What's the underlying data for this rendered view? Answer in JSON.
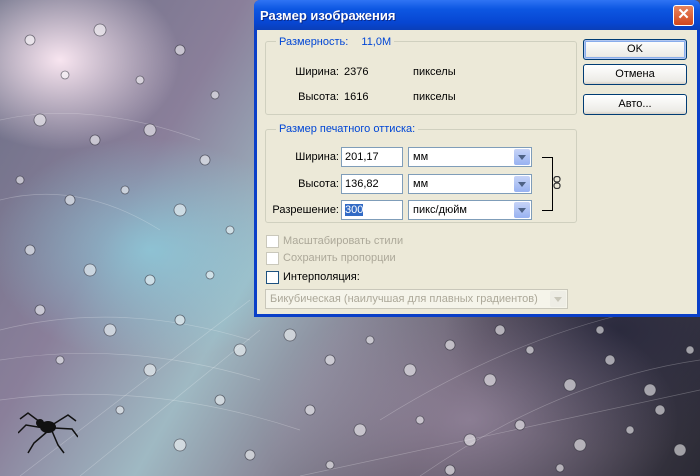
{
  "dialog": {
    "title": "Размер изображения",
    "close_glyph": "✕"
  },
  "pixel_dimensions": {
    "legend": "Размерность:",
    "size": "11,0M",
    "width_label": "Ширина:",
    "width_value": "2376",
    "width_unit": "пикселы",
    "height_label": "Высота:",
    "height_value": "1616",
    "height_unit": "пикселы"
  },
  "document_size": {
    "legend": "Размер печатного оттиска:",
    "width_label": "Ширина:",
    "width_value": "201,17",
    "width_unit": "мм",
    "height_label": "Высота:",
    "height_value": "136,82",
    "height_unit": "мм",
    "resolution_label": "Разрешение:",
    "resolution_value": "300",
    "resolution_unit": "пикс/дюйм"
  },
  "options": {
    "scale_styles": {
      "label": "Масштабировать стили",
      "checked": false,
      "enabled": false
    },
    "constrain": {
      "label": "Сохранить пропорции",
      "checked": false,
      "enabled": false
    },
    "resample": {
      "label": "Интерполяция:",
      "checked": false,
      "enabled": true
    },
    "resample_method": "Бикубическая (наилучшая для плавных градиентов)"
  },
  "buttons": {
    "ok": "OK",
    "cancel": "Отмена",
    "auto": "Авто..."
  },
  "colors": {
    "title_bar": "#0a52dc",
    "dialog_face": "#ece9d8",
    "legend_text": "#0046d5",
    "selection": "#316ac5"
  },
  "icons": [
    "close-icon",
    "chain-link-icon",
    "chevron-down-icon",
    "spider-icon"
  ]
}
